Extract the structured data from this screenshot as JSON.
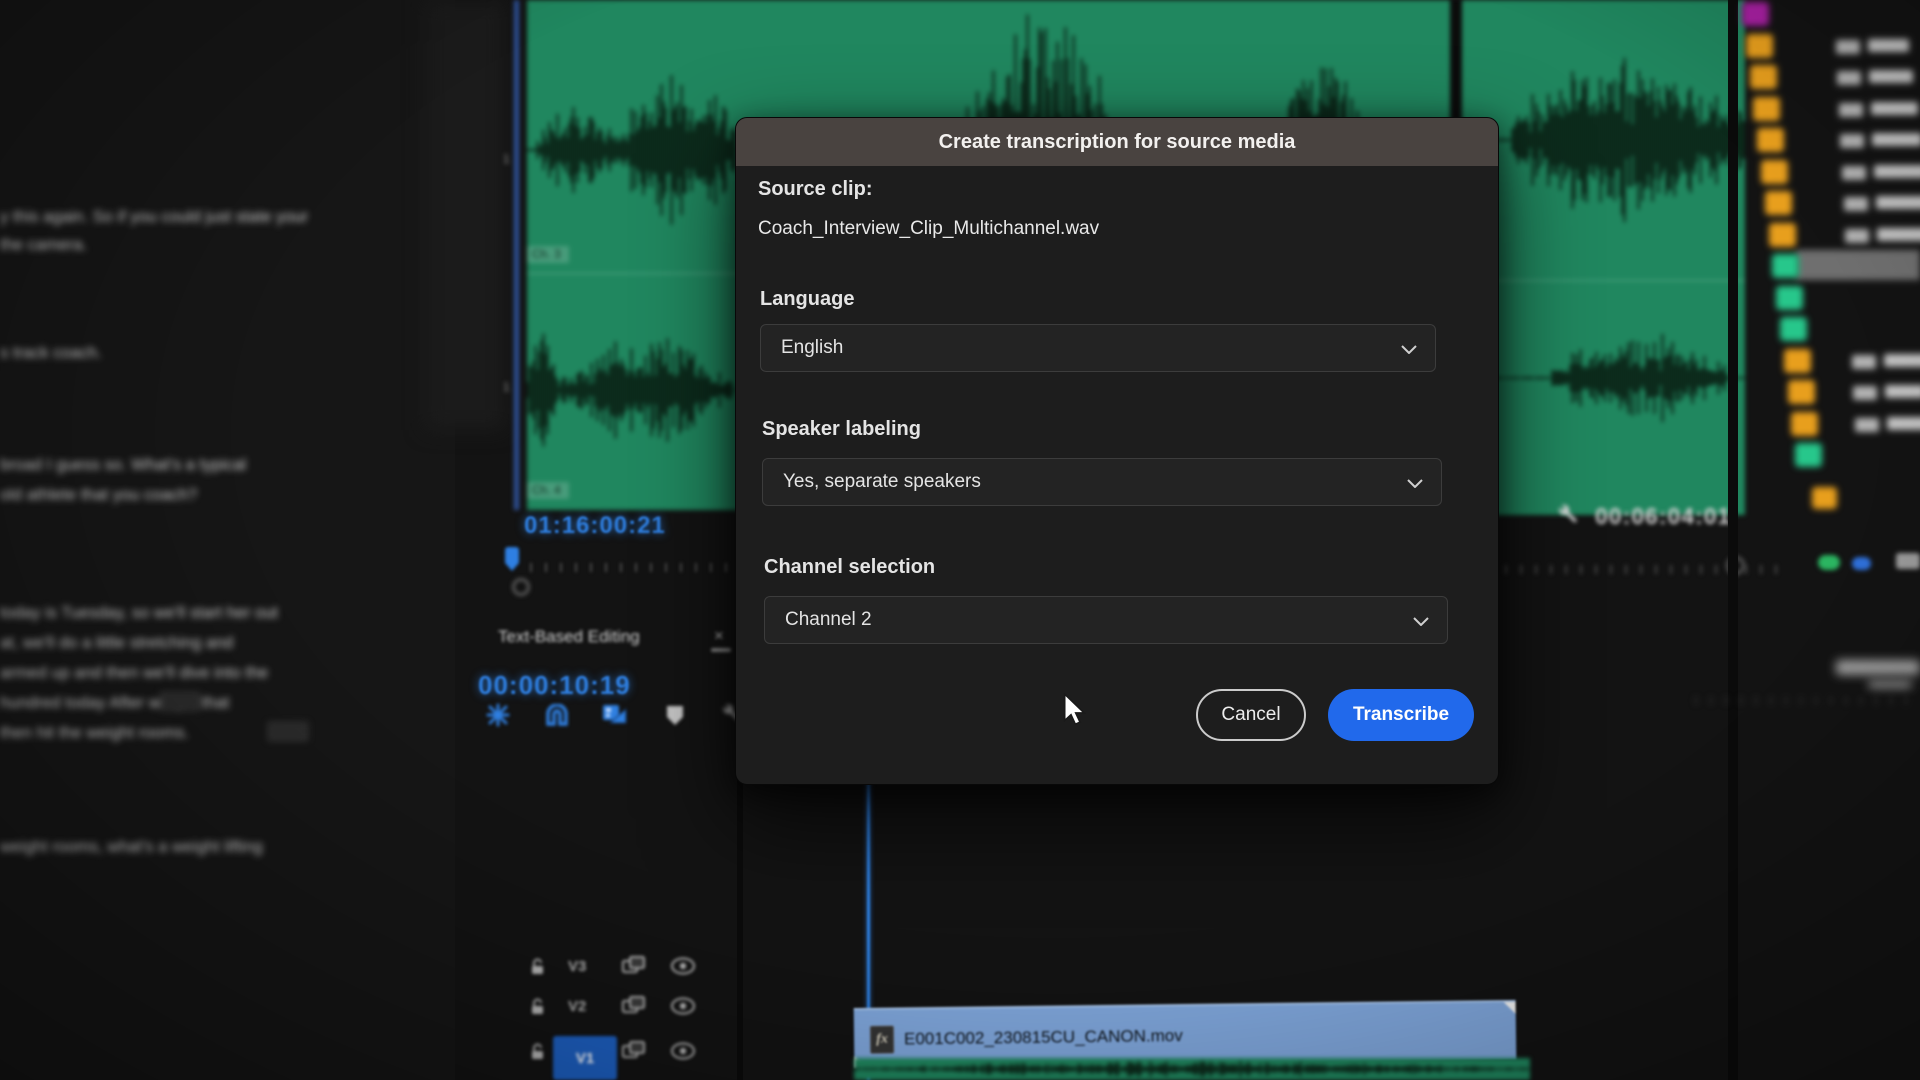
{
  "dialog": {
    "title": "Create transcription for source media",
    "source_clip_label": "Source clip:",
    "source_clip_value": "Coach_Interview_Clip_Multichannel.wav",
    "language": {
      "label": "Language",
      "value": "English"
    },
    "speaker_labeling": {
      "label": "Speaker labeling",
      "value": "Yes, separate speakers"
    },
    "channel_selection": {
      "label": "Channel selection",
      "value": "Channel 2"
    },
    "buttons": {
      "cancel": "Cancel",
      "transcribe": "Transcribe"
    },
    "colors": {
      "transcribe_blue": "#2169eb",
      "title_bar": "#494340",
      "body": "#1d1d1d"
    }
  },
  "source_monitor": {
    "timecode": "01:16:00:21",
    "channel_labels": [
      "Ch. 3",
      "Ch. 4"
    ],
    "track_numbers": [
      "1",
      "1"
    ],
    "waveform_green": "#20875f"
  },
  "program_monitor": {
    "timecode": "00:06:04:01"
  },
  "text_based_editing": {
    "tab_label": "Text-Based Editing",
    "close_glyph": "×",
    "timecode": "00:00:10:19",
    "timecode_blue": "#2e7ddd",
    "transcript_lines": [
      "y this again. So if you could just state your",
      "the camera.",
      "s track coach.",
      "broad I guess so. What's a typical",
      "old athlete that you coach?",
      "today is Tuesday, so we'll start her out",
      "at, we'll do a little stretching and",
      "armed up and then we'll dive into the",
      "hundred today        After we get that",
      "then hit the weight rooms.",
      "weight rooms, what's a weight lifting"
    ]
  },
  "timeline": {
    "video_tracks": [
      {
        "label": "V3"
      },
      {
        "label": "V2"
      },
      {
        "label": "V1"
      }
    ],
    "selected_track": "V1",
    "clip": {
      "fx_badge": "fx",
      "name": "E001C002_230815CU_CANON.mov",
      "color": "#7fa6db"
    }
  },
  "right_panel": {
    "swatch_colors": [
      "#a820a2",
      "#e89f1d",
      "#e89f1d",
      "#e89f1d",
      "#e89f1d",
      "#e89f1d",
      "#e89f1d",
      "#e89f1d",
      "#27c78b",
      "#27c78b",
      "#27c78b",
      "#e89f1d",
      "#e89f1d",
      "#e89f1d",
      "#27c78b"
    ]
  }
}
